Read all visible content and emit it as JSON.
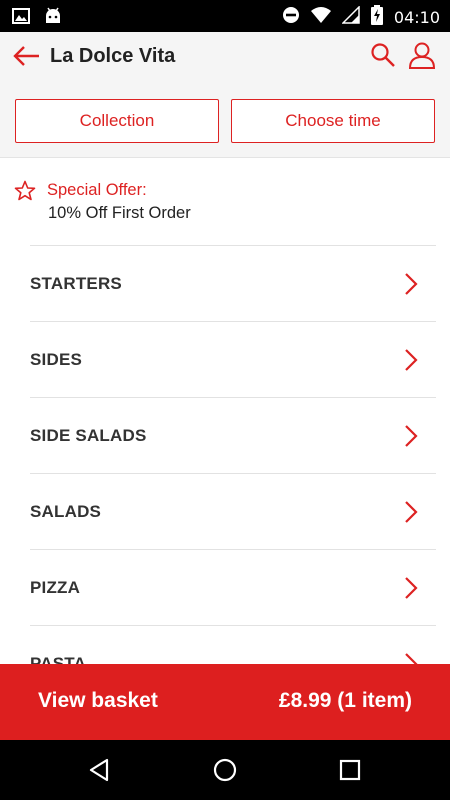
{
  "status_bar": {
    "time": "04:10",
    "icons": [
      "image-icon",
      "android-icon",
      "do-not-disturb-icon",
      "wifi-icon",
      "signal-icon",
      "battery-charging-icon"
    ]
  },
  "header": {
    "title": "La Dolce Vita",
    "icons": [
      "back-arrow-icon",
      "search-icon",
      "account-icon"
    ],
    "accent_color": "#dd2222"
  },
  "order_options": {
    "collection_label": "Collection",
    "time_label": "Choose time"
  },
  "offer": {
    "icon": "star-icon",
    "title": "Special Offer:",
    "detail": "10% Off First Order"
  },
  "menu": {
    "items": [
      {
        "label": "STARTERS"
      },
      {
        "label": "SIDES"
      },
      {
        "label": "SIDE SALADS"
      },
      {
        "label": "SALADS"
      },
      {
        "label": "PIZZA"
      },
      {
        "label": "PASTA"
      }
    ]
  },
  "basket": {
    "label": "View basket",
    "total": "£8.99 (1 item)",
    "color": "#dd1f1f"
  },
  "nav_bar": {
    "icons": [
      "back-triangle-icon",
      "home-circle-icon",
      "recents-square-icon"
    ]
  }
}
